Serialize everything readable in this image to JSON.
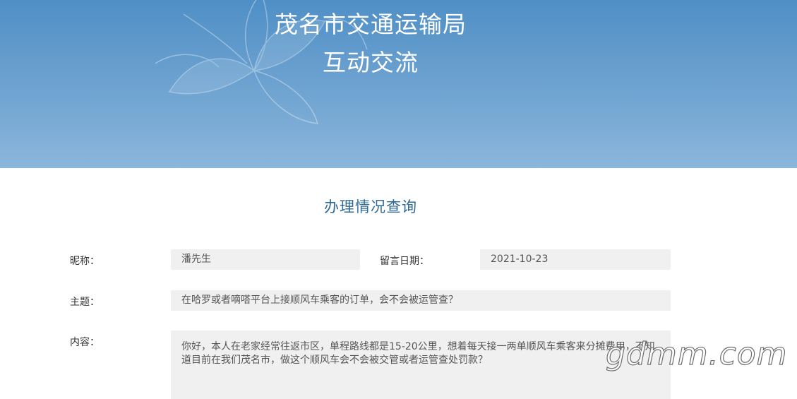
{
  "header": {
    "title_line1": "茂名市交通运输局",
    "title_line2": "互动交流",
    "background_colors": [
      "#4f8fc6",
      "#8bb6db"
    ]
  },
  "section": {
    "title": "办理情况查询",
    "title_color": "#2f6a96"
  },
  "form": {
    "nickname_label": "昵称：",
    "nickname_value": "潘先生",
    "date_label": "留言日期：",
    "date_value": "2021-10-23",
    "subject_label": "主题：",
    "subject_value": "在哈罗或者嘀嗒平台上接顺风车乘客的订单，会不会被运管查？",
    "content_label": "内容：",
    "content_value": "你好，本人在老家经常往返市区，单程路线都是15-20公里，想着每天接一两单顺风车乘客来分摊费用，不知道目前在我们茂名市，做这个顺风车会不会被交管或者运管查处罚款？"
  },
  "watermark": {
    "text": "gdmm.com"
  }
}
